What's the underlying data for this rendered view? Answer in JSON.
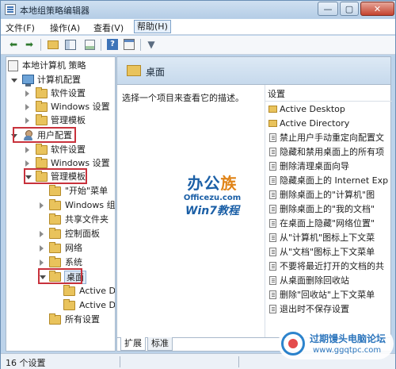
{
  "window": {
    "title": "本地组策略编辑器",
    "buttons": {
      "minimize": "—",
      "maximize": "▢",
      "close": "✕"
    }
  },
  "menu": [
    {
      "label": "文件(F)"
    },
    {
      "label": "操作(A)"
    },
    {
      "label": "查看(V)"
    },
    {
      "label": "帮助(H)"
    }
  ],
  "toolbar": {
    "icons": [
      "back-arrow-icon",
      "forward-arrow-icon",
      "up-folder-icon",
      "show-hide-tree-icon",
      "export-list-icon",
      "help-icon",
      "properties-icon",
      "filter-icon"
    ]
  },
  "tree": {
    "root": "本地计算机 策略",
    "computer_config": "计算机配置",
    "cc_software": "软件设置",
    "cc_windows": "Windows 设置",
    "cc_admin": "管理模板",
    "user_config": "用户配置",
    "uc_software": "软件设置",
    "uc_windows": "Windows 设置",
    "uc_admin": "管理模板",
    "start_menu": "\"开始\"菜单",
    "windows_components": "Windows 组件",
    "shared_folders": "共享文件夹",
    "control_panel": "控制面板",
    "network": "网络",
    "system": "系统",
    "desktop": "桌面",
    "active_desktop": "Active De",
    "active_directory": "Active Dir",
    "all_settings": "所有设置"
  },
  "right_pane": {
    "header_title": "桌面",
    "description": "选择一个项目来查看它的描述。",
    "list_header": "设置",
    "items": [
      "Active Desktop",
      "Active Directory",
      "禁止用户手动重定向配置文",
      "隐藏和禁用桌面上的所有项",
      "删除清理桌面向导",
      "隐藏桌面上的 Internet Exp",
      "删除桌面上的\"计算机\"图",
      "删除桌面上的\"我的文档\"",
      "在桌面上隐藏\"网络位置\"",
      "从\"计算机\"图标上下文菜",
      "从\"文档\"图标上下文菜单",
      "不要将最近打开的文档的共",
      "从桌面删除回收站",
      "删除\"回收站\"上下文菜单",
      "退出时不保存设置"
    ]
  },
  "tabs": {
    "extended": "扩展",
    "standard": "标准"
  },
  "status": {
    "text": "16 个设置"
  },
  "watermark": {
    "logo_main": "办公",
    "logo_accent": "族",
    "url": "Officezu.com",
    "sub": "Win7教程"
  },
  "badge": {
    "title": "过期馒头电脑论坛",
    "url": "www.ggqtpc.com"
  }
}
